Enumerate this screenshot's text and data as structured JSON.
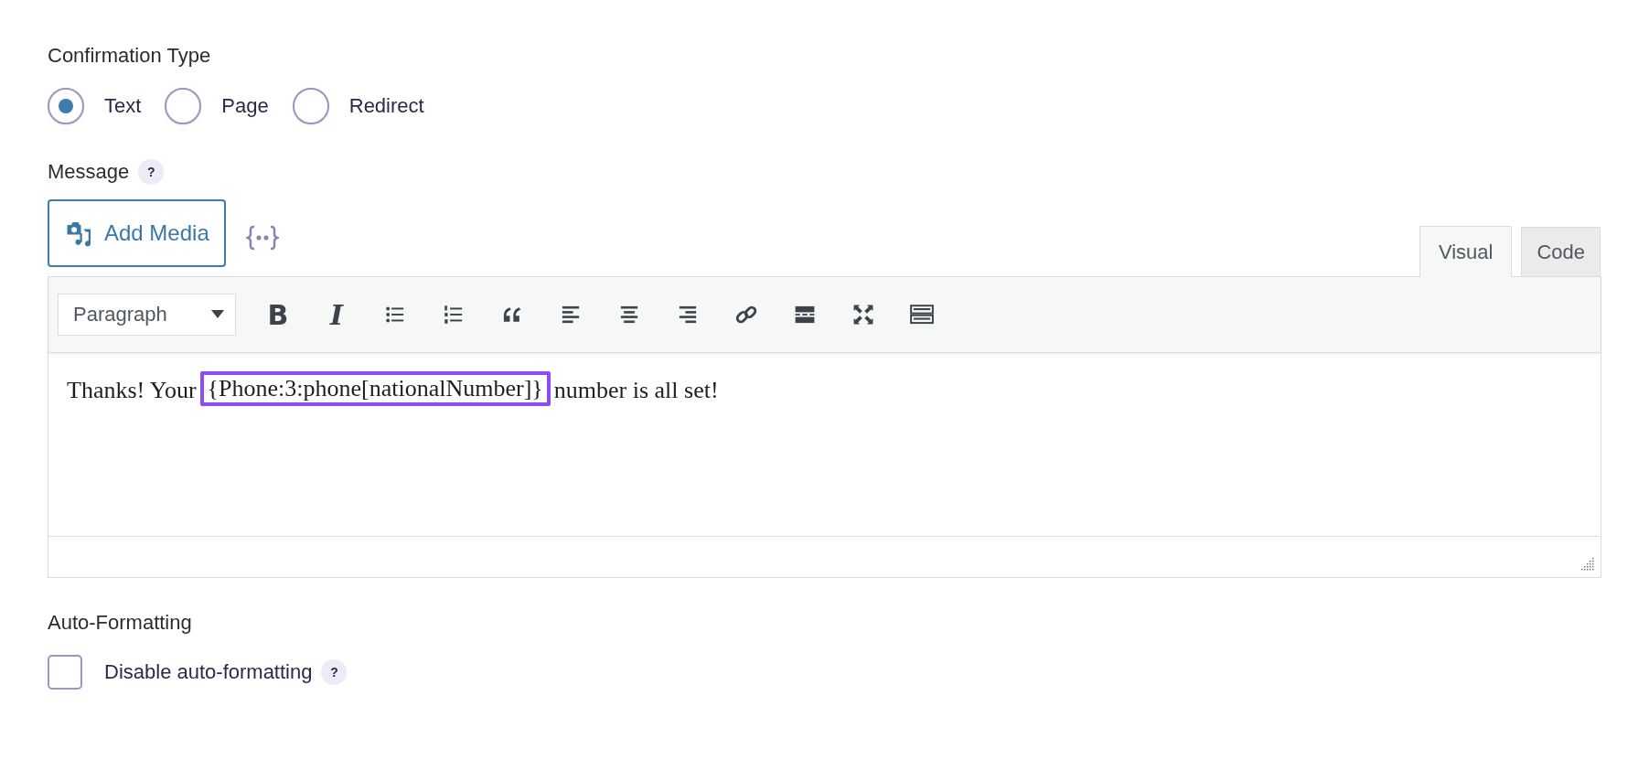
{
  "confirmation_type": {
    "label": "Confirmation Type",
    "options": [
      {
        "label": "Text",
        "selected": true
      },
      {
        "label": "Page",
        "selected": false
      },
      {
        "label": "Redirect",
        "selected": false
      }
    ]
  },
  "message": {
    "label": "Message",
    "help": "?",
    "add_media": "Add Media",
    "tabs": [
      {
        "label": "Visual",
        "selected": true
      },
      {
        "label": "Code",
        "selected": false
      }
    ],
    "format_select": "Paragraph",
    "bold": "B",
    "italic": "I",
    "content": {
      "before": "Thanks! Your",
      "merge_tag": "{Phone:3:phone[nationalNumber]}",
      "after": "number is all set!"
    }
  },
  "auto_formatting": {
    "label": "Auto-Formatting",
    "checkbox": {
      "label": "Disable auto-formatting",
      "checked": false,
      "help": "?"
    }
  }
}
